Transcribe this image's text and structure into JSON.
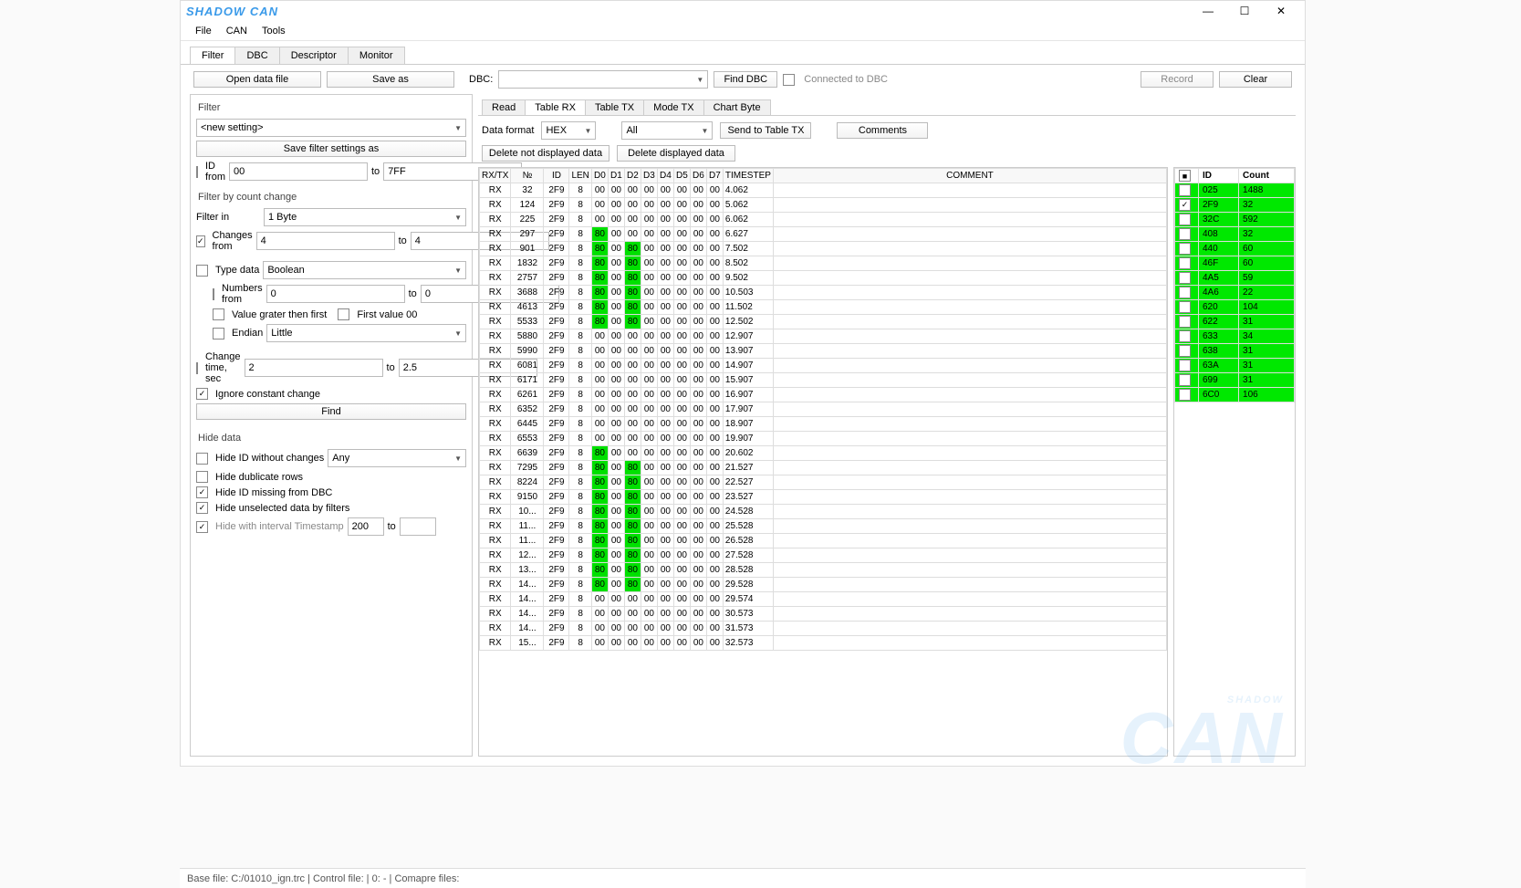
{
  "title": "SHADOW CAN",
  "watermark_line1": "SHADOW",
  "watermark_line2": "CAN",
  "menubar": [
    "File",
    "CAN",
    "Tools"
  ],
  "main_tabs": [
    "Filter",
    "DBC",
    "Descriptor",
    "Monitor"
  ],
  "active_tab": 0,
  "toolbar": {
    "open": "Open data file",
    "saveas": "Save as",
    "dbc_label": "DBC:",
    "dbc_value": "",
    "find_dbc": "Find DBC",
    "connected": "Connected to DBC",
    "record": "Record",
    "clear": "Clear"
  },
  "filter": {
    "title": "Filter",
    "setting_select": "<new setting>",
    "save_settings": "Save filter settings as",
    "id_from_label": "ID from",
    "id_from": "00",
    "id_to_label": "to",
    "id_to": "7FF",
    "count_title": "Filter by count change",
    "filter_in_label": "Filter in",
    "filter_in": "1 Byte",
    "changes_from_label": "Changes from",
    "changes_from": "4",
    "changes_to": "4",
    "type_data_label": "Type data",
    "type_data": "Boolean",
    "numbers_from_label": "Numbers from",
    "numbers_from": "0",
    "numbers_to": "0",
    "value_greater": "Value grater then first",
    "first_value": "First value 00",
    "endian_label": "Endian",
    "endian": "Little",
    "change_time_label": "Change time, sec",
    "change_time_from": "2",
    "change_time_to": "2.5",
    "ignore_constant": "Ignore constant change",
    "find": "Find",
    "hide_title": "Hide data",
    "hide_wo_changes": "Hide ID without changes",
    "hide_wo_changes_sel": "Any",
    "hide_dup": "Hide dublicate rows",
    "hide_missing": "Hide ID missing from DBC",
    "hide_unsel": "Hide unselected data by filters",
    "hide_interval": "Hide with interval Timestamp",
    "hide_interval_val": "200",
    "to": "to"
  },
  "sub_tabs": [
    "Read",
    "Table RX",
    "Table TX",
    "Mode TX",
    "Chart Byte"
  ],
  "active_subtab": 1,
  "rx": {
    "data_format_label": "Data format",
    "data_format": "HEX",
    "all": "All",
    "send_tx": "Send to Table TX",
    "comments": "Comments",
    "del_not_disp": "Delete not displayed data",
    "del_disp": "Delete displayed data",
    "headers": [
      "RX/TX",
      "№",
      "ID",
      "LEN",
      "D0",
      "D1",
      "D2",
      "D3",
      "D4",
      "D5",
      "D6",
      "D7",
      "TIMESTEP",
      "COMMENT"
    ]
  },
  "rows": [
    {
      "rt": "RX",
      "no": "32",
      "id": "2F9",
      "len": "8",
      "d": [
        "00",
        "00",
        "00",
        "00",
        "00",
        "00",
        "00",
        "00"
      ],
      "ts": "4.062",
      "g": []
    },
    {
      "rt": "RX",
      "no": "124",
      "id": "2F9",
      "len": "8",
      "d": [
        "00",
        "00",
        "00",
        "00",
        "00",
        "00",
        "00",
        "00"
      ],
      "ts": "5.062",
      "g": []
    },
    {
      "rt": "RX",
      "no": "225",
      "id": "2F9",
      "len": "8",
      "d": [
        "00",
        "00",
        "00",
        "00",
        "00",
        "00",
        "00",
        "00"
      ],
      "ts": "6.062",
      "g": []
    },
    {
      "rt": "RX",
      "no": "297",
      "id": "2F9",
      "len": "8",
      "d": [
        "80",
        "00",
        "00",
        "00",
        "00",
        "00",
        "00",
        "00"
      ],
      "ts": "6.627",
      "g": [
        0
      ]
    },
    {
      "rt": "RX",
      "no": "901",
      "id": "2F9",
      "len": "8",
      "d": [
        "80",
        "00",
        "80",
        "00",
        "00",
        "00",
        "00",
        "00"
      ],
      "ts": "7.502",
      "g": [
        0,
        2
      ]
    },
    {
      "rt": "RX",
      "no": "1832",
      "id": "2F9",
      "len": "8",
      "d": [
        "80",
        "00",
        "80",
        "00",
        "00",
        "00",
        "00",
        "00"
      ],
      "ts": "8.502",
      "g": [
        0,
        2
      ]
    },
    {
      "rt": "RX",
      "no": "2757",
      "id": "2F9",
      "len": "8",
      "d": [
        "80",
        "00",
        "80",
        "00",
        "00",
        "00",
        "00",
        "00"
      ],
      "ts": "9.502",
      "g": [
        0,
        2
      ]
    },
    {
      "rt": "RX",
      "no": "3688",
      "id": "2F9",
      "len": "8",
      "d": [
        "80",
        "00",
        "80",
        "00",
        "00",
        "00",
        "00",
        "00"
      ],
      "ts": "10.503",
      "g": [
        0,
        2
      ]
    },
    {
      "rt": "RX",
      "no": "4613",
      "id": "2F9",
      "len": "8",
      "d": [
        "80",
        "00",
        "80",
        "00",
        "00",
        "00",
        "00",
        "00"
      ],
      "ts": "11.502",
      "g": [
        0,
        2
      ]
    },
    {
      "rt": "RX",
      "no": "5533",
      "id": "2F9",
      "len": "8",
      "d": [
        "80",
        "00",
        "80",
        "00",
        "00",
        "00",
        "00",
        "00"
      ],
      "ts": "12.502",
      "g": [
        0,
        2
      ]
    },
    {
      "rt": "RX",
      "no": "5880",
      "id": "2F9",
      "len": "8",
      "d": [
        "00",
        "00",
        "00",
        "00",
        "00",
        "00",
        "00",
        "00"
      ],
      "ts": "12.907",
      "g": []
    },
    {
      "rt": "RX",
      "no": "5990",
      "id": "2F9",
      "len": "8",
      "d": [
        "00",
        "00",
        "00",
        "00",
        "00",
        "00",
        "00",
        "00"
      ],
      "ts": "13.907",
      "g": []
    },
    {
      "rt": "RX",
      "no": "6081",
      "id": "2F9",
      "len": "8",
      "d": [
        "00",
        "00",
        "00",
        "00",
        "00",
        "00",
        "00",
        "00"
      ],
      "ts": "14.907",
      "g": []
    },
    {
      "rt": "RX",
      "no": "6171",
      "id": "2F9",
      "len": "8",
      "d": [
        "00",
        "00",
        "00",
        "00",
        "00",
        "00",
        "00",
        "00"
      ],
      "ts": "15.907",
      "g": []
    },
    {
      "rt": "RX",
      "no": "6261",
      "id": "2F9",
      "len": "8",
      "d": [
        "00",
        "00",
        "00",
        "00",
        "00",
        "00",
        "00",
        "00"
      ],
      "ts": "16.907",
      "g": []
    },
    {
      "rt": "RX",
      "no": "6352",
      "id": "2F9",
      "len": "8",
      "d": [
        "00",
        "00",
        "00",
        "00",
        "00",
        "00",
        "00",
        "00"
      ],
      "ts": "17.907",
      "g": []
    },
    {
      "rt": "RX",
      "no": "6445",
      "id": "2F9",
      "len": "8",
      "d": [
        "00",
        "00",
        "00",
        "00",
        "00",
        "00",
        "00",
        "00"
      ],
      "ts": "18.907",
      "g": []
    },
    {
      "rt": "RX",
      "no": "6553",
      "id": "2F9",
      "len": "8",
      "d": [
        "00",
        "00",
        "00",
        "00",
        "00",
        "00",
        "00",
        "00"
      ],
      "ts": "19.907",
      "g": []
    },
    {
      "rt": "RX",
      "no": "6639",
      "id": "2F9",
      "len": "8",
      "d": [
        "80",
        "00",
        "00",
        "00",
        "00",
        "00",
        "00",
        "00"
      ],
      "ts": "20.602",
      "g": [
        0
      ]
    },
    {
      "rt": "RX",
      "no": "7295",
      "id": "2F9",
      "len": "8",
      "d": [
        "80",
        "00",
        "80",
        "00",
        "00",
        "00",
        "00",
        "00"
      ],
      "ts": "21.527",
      "g": [
        0,
        2
      ]
    },
    {
      "rt": "RX",
      "no": "8224",
      "id": "2F9",
      "len": "8",
      "d": [
        "80",
        "00",
        "80",
        "00",
        "00",
        "00",
        "00",
        "00"
      ],
      "ts": "22.527",
      "g": [
        0,
        2
      ]
    },
    {
      "rt": "RX",
      "no": "9150",
      "id": "2F9",
      "len": "8",
      "d": [
        "80",
        "00",
        "80",
        "00",
        "00",
        "00",
        "00",
        "00"
      ],
      "ts": "23.527",
      "g": [
        0,
        2
      ]
    },
    {
      "rt": "RX",
      "no": "10...",
      "id": "2F9",
      "len": "8",
      "d": [
        "80",
        "00",
        "80",
        "00",
        "00",
        "00",
        "00",
        "00"
      ],
      "ts": "24.528",
      "g": [
        0,
        2
      ]
    },
    {
      "rt": "RX",
      "no": "11...",
      "id": "2F9",
      "len": "8",
      "d": [
        "80",
        "00",
        "80",
        "00",
        "00",
        "00",
        "00",
        "00"
      ],
      "ts": "25.528",
      "g": [
        0,
        2
      ]
    },
    {
      "rt": "RX",
      "no": "11...",
      "id": "2F9",
      "len": "8",
      "d": [
        "80",
        "00",
        "80",
        "00",
        "00",
        "00",
        "00",
        "00"
      ],
      "ts": "26.528",
      "g": [
        0,
        2
      ]
    },
    {
      "rt": "RX",
      "no": "12...",
      "id": "2F9",
      "len": "8",
      "d": [
        "80",
        "00",
        "80",
        "00",
        "00",
        "00",
        "00",
        "00"
      ],
      "ts": "27.528",
      "g": [
        0,
        2
      ]
    },
    {
      "rt": "RX",
      "no": "13...",
      "id": "2F9",
      "len": "8",
      "d": [
        "80",
        "00",
        "80",
        "00",
        "00",
        "00",
        "00",
        "00"
      ],
      "ts": "28.528",
      "g": [
        0,
        2
      ]
    },
    {
      "rt": "RX",
      "no": "14...",
      "id": "2F9",
      "len": "8",
      "d": [
        "80",
        "00",
        "80",
        "00",
        "00",
        "00",
        "00",
        "00"
      ],
      "ts": "29.528",
      "g": [
        0,
        2
      ]
    },
    {
      "rt": "RX",
      "no": "14...",
      "id": "2F9",
      "len": "8",
      "d": [
        "00",
        "00",
        "00",
        "00",
        "00",
        "00",
        "00",
        "00"
      ],
      "ts": "29.574",
      "g": []
    },
    {
      "rt": "RX",
      "no": "14...",
      "id": "2F9",
      "len": "8",
      "d": [
        "00",
        "00",
        "00",
        "00",
        "00",
        "00",
        "00",
        "00"
      ],
      "ts": "30.573",
      "g": []
    },
    {
      "rt": "RX",
      "no": "14...",
      "id": "2F9",
      "len": "8",
      "d": [
        "00",
        "00",
        "00",
        "00",
        "00",
        "00",
        "00",
        "00"
      ],
      "ts": "31.573",
      "g": []
    },
    {
      "rt": "RX",
      "no": "15...",
      "id": "2F9",
      "len": "8",
      "d": [
        "00",
        "00",
        "00",
        "00",
        "00",
        "00",
        "00",
        "00"
      ],
      "ts": "32.573",
      "g": []
    }
  ],
  "side_headers": [
    "",
    "ID",
    "Count"
  ],
  "side_rows": [
    {
      "chk": false,
      "id": "025",
      "count": "1488"
    },
    {
      "chk": true,
      "id": "2F9",
      "count": "32"
    },
    {
      "chk": false,
      "id": "32C",
      "count": "592"
    },
    {
      "chk": false,
      "id": "408",
      "count": "32"
    },
    {
      "chk": false,
      "id": "440",
      "count": "60"
    },
    {
      "chk": false,
      "id": "46F",
      "count": "60"
    },
    {
      "chk": false,
      "id": "4A5",
      "count": "59"
    },
    {
      "chk": false,
      "id": "4A6",
      "count": "22"
    },
    {
      "chk": false,
      "id": "620",
      "count": "104"
    },
    {
      "chk": false,
      "id": "622",
      "count": "31"
    },
    {
      "chk": false,
      "id": "633",
      "count": "34"
    },
    {
      "chk": false,
      "id": "638",
      "count": "31"
    },
    {
      "chk": false,
      "id": "63A",
      "count": "31"
    },
    {
      "chk": false,
      "id": "699",
      "count": "31"
    },
    {
      "chk": false,
      "id": "6C0",
      "count": "106"
    }
  ],
  "statusbar": "Base file: C:/01010_ign.trc | Control file:  | 0: - | Comapre files:"
}
